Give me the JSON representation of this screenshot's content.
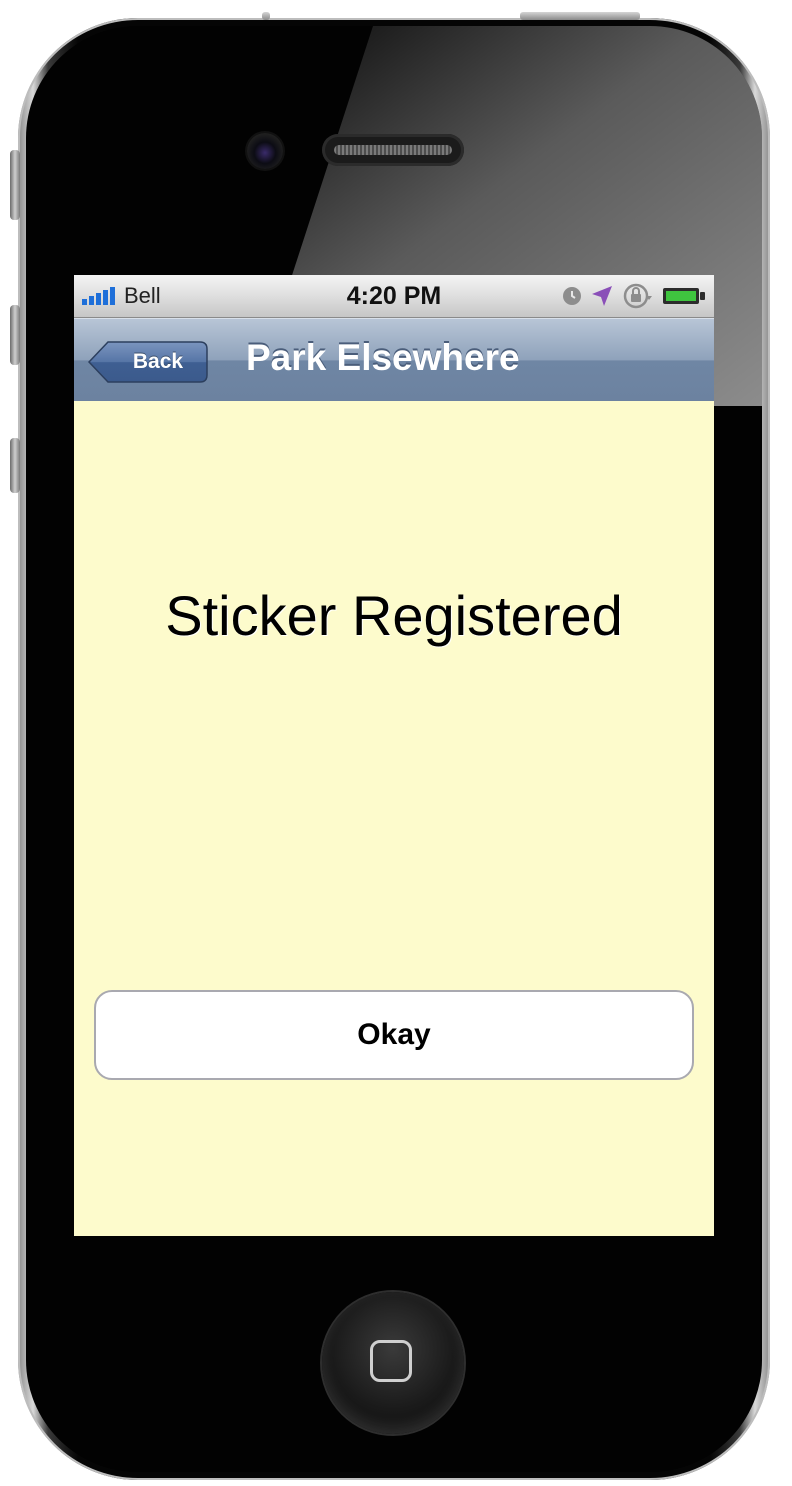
{
  "status_bar": {
    "carrier": "Bell",
    "time": "4:20 PM",
    "signal_bars": 5,
    "icons": [
      "clock-icon",
      "location-arrow-icon",
      "rotation-lock-icon",
      "battery-icon"
    ]
  },
  "nav_bar": {
    "back_label": "Back",
    "title": "Park Elsewhere"
  },
  "content": {
    "message": "Sticker Registered",
    "okay_label": "Okay",
    "background": "#fdfbcc"
  },
  "colors": {
    "nav_bar": "#8fa2bb",
    "back_button": "#4d6c9e",
    "location_icon": "#8a4fb8",
    "battery_fill": "#3fc43f",
    "signal": "#1e6fd9"
  }
}
